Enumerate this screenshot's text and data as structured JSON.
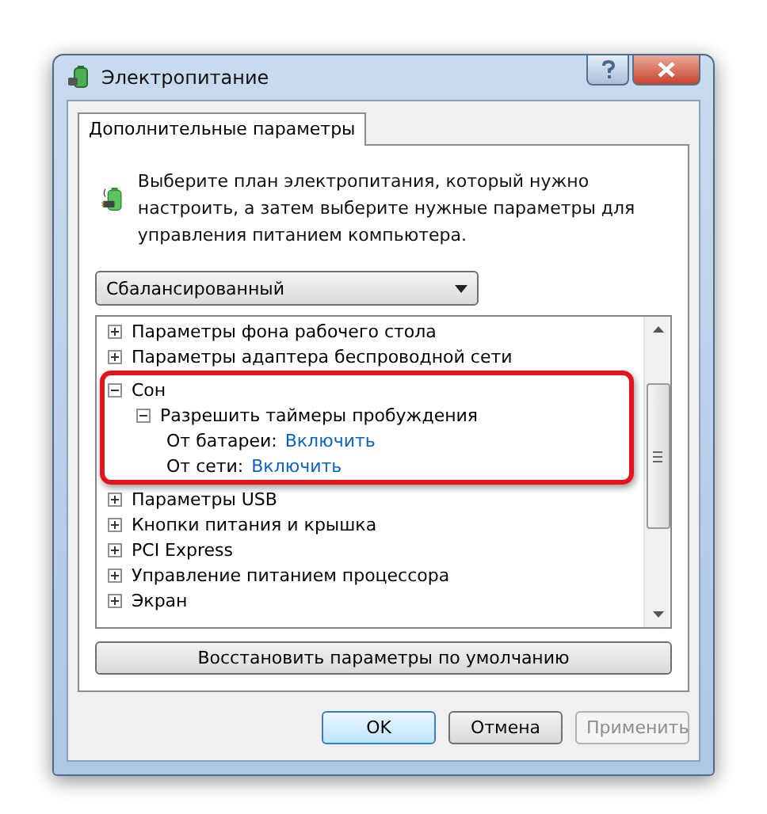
{
  "window": {
    "title": "Электропитание"
  },
  "tabs": [
    {
      "label": "Дополнительные параметры",
      "selected": true
    }
  ],
  "description": "Выберите план электропитания, который нужно настроить, а затем выберите нужные параметры для управления питанием компьютера.",
  "plan_dropdown": {
    "value": "Сбалансированный"
  },
  "tree": [
    {
      "label": "Параметры фона рабочего стола",
      "expanded": false,
      "highlighted": false
    },
    {
      "label": "Параметры адаптера беспроводной сети",
      "expanded": false,
      "highlighted": false
    },
    {
      "label": "Сон",
      "expanded": true,
      "highlighted": true,
      "children": [
        {
          "label": "Разрешить таймеры пробуждения",
          "expanded": true,
          "settings": [
            {
              "label": "От батареи:",
              "value": "Включить"
            },
            {
              "label": "От сети:",
              "value": "Включить"
            }
          ]
        }
      ]
    },
    {
      "label": "Параметры USB",
      "expanded": false,
      "highlighted": false
    },
    {
      "label": "Кнопки питания и крышка",
      "expanded": false,
      "highlighted": false
    },
    {
      "label": "PCI Express",
      "expanded": false,
      "highlighted": false
    },
    {
      "label": "Управление питанием процессора",
      "expanded": false,
      "highlighted": false
    },
    {
      "label": "Экран",
      "expanded": false,
      "highlighted": false
    }
  ],
  "restore_button": "Восстановить параметры по умолчанию",
  "buttons": [
    {
      "label": "OK",
      "kind": "default",
      "disabled": false
    },
    {
      "label": "Отмена",
      "kind": "normal",
      "disabled": false
    },
    {
      "label": "Применить",
      "kind": "normal",
      "disabled": true
    }
  ]
}
